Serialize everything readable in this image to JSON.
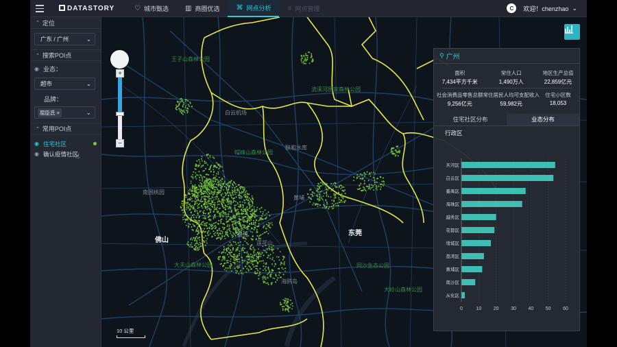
{
  "topbar": {
    "logo": "DATASTORY",
    "nav": [
      {
        "label": "城市甄选",
        "icon": "heart-icon"
      },
      {
        "label": "商圈优选",
        "icon": "building-icon"
      },
      {
        "label": "网点分析",
        "icon": "map-icon",
        "active": true
      },
      {
        "label": "网点管理",
        "icon": "list-icon",
        "dimmed": true
      }
    ],
    "avatar_letter": "C",
    "greeting": "欢迎！chenzhao"
  },
  "sidebar": {
    "location_header": "定位",
    "location_value": "广东 / 广州",
    "search_header": "搜索POI点",
    "business_label": "业态：",
    "business_value": "超市",
    "brand_label": "品牌：",
    "brand_tag": "屈臣氏",
    "common_header": "常用POI点",
    "poi_items": [
      {
        "label": "住宅社区",
        "active": true
      },
      {
        "label": "确认疫情社区",
        "active": false
      }
    ]
  },
  "map": {
    "scale_label": "10 公里",
    "labels": [
      {
        "text": "佛山",
        "big": true
      },
      {
        "text": "东莞",
        "big": true
      },
      {
        "text": "南国桃园"
      },
      {
        "text": "大夫山森林公园"
      },
      {
        "text": "同沙生态公园"
      },
      {
        "text": "大岭山森林公园"
      },
      {
        "text": "莲花山"
      },
      {
        "text": "王子山森林公园"
      },
      {
        "text": "流溪河国家森林公园"
      },
      {
        "text": "白云机场"
      },
      {
        "text": "帽峰山森林公园"
      },
      {
        "text": "联和水库"
      },
      {
        "text": "海鸥岛"
      },
      {
        "text": "黄埔"
      },
      {
        "text": "番禺"
      }
    ]
  },
  "panel": {
    "city": "广州",
    "stats": [
      {
        "label": "面积",
        "value": "7,434平方千米"
      },
      {
        "label": "常住人口",
        "value": "1,490万人"
      },
      {
        "label": "地区生产总值",
        "value": "22,859亿元"
      },
      {
        "label": "社会消费品零售总额",
        "value": "9,256亿元"
      },
      {
        "label": "常住居民人均可支配收入",
        "value": "59,982元"
      },
      {
        "label": "住宅小区数",
        "value": "18,053"
      }
    ],
    "tabs": [
      {
        "label": "住宅社区分布",
        "active": false
      },
      {
        "label": "业态分布",
        "active": true
      }
    ],
    "subtitle": "行政区"
  },
  "chart_data": {
    "type": "bar",
    "orientation": "horizontal",
    "categories": [
      "天河区",
      "白云区",
      "番禺区",
      "海珠区",
      "越秀区",
      "花都区",
      "增城区",
      "荔湾区",
      "黄埔区",
      "南沙区",
      "从化区"
    ],
    "values": [
      54,
      53,
      37,
      35,
      20,
      19,
      17,
      13,
      12,
      8,
      2
    ],
    "xlim": [
      0,
      60
    ],
    "xticks": [
      0,
      10,
      20,
      30,
      40,
      50,
      60
    ],
    "bar_color": "#3fbfb4",
    "grid": true
  }
}
